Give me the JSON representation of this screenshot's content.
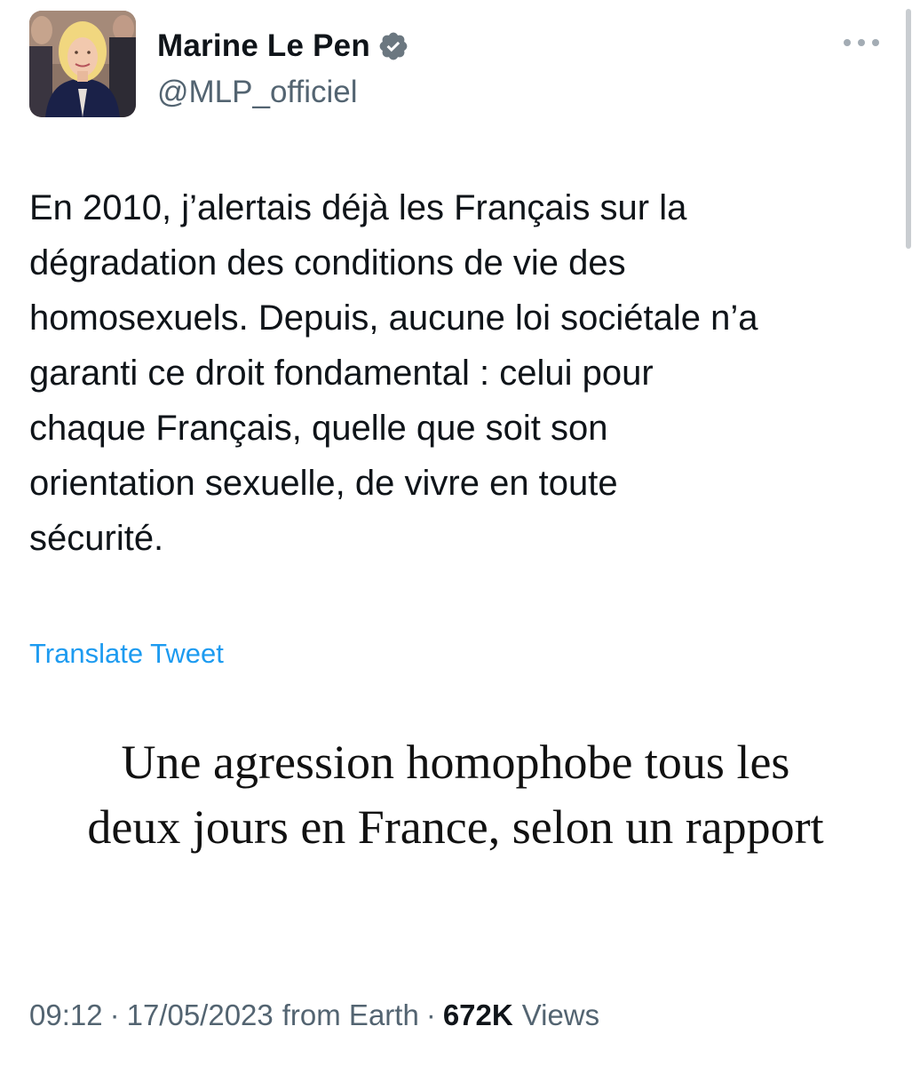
{
  "author": {
    "display_name": "Marine Le Pen",
    "handle": "@MLP_officiel",
    "verified_icon": "verified-badge-icon",
    "verified_color": "#6b7780"
  },
  "tweet": {
    "text": "En 2010, j’alertais déjà les Français sur la\ndégradation des conditions de vie des\nhomosexuels. Depuis, aucune loi sociétale n’a\ngaranti ce droit fondamental : celui pour\nchaque Français, quelle que soit son\norientation sexuelle, de vivre en toute\nsécurité.",
    "translate_label": "Translate Tweet",
    "media_headline": "Une agression homophobe tous les deux jours en France, selon un rapport"
  },
  "meta": {
    "time": "09:12",
    "date": "17/05/2023",
    "source": "from Earth",
    "separator": "·",
    "views_count": "672K",
    "views_label": "Views"
  },
  "colors": {
    "link": "#1d9bf0",
    "secondary_text": "#536471",
    "primary_text": "#0f1419"
  }
}
